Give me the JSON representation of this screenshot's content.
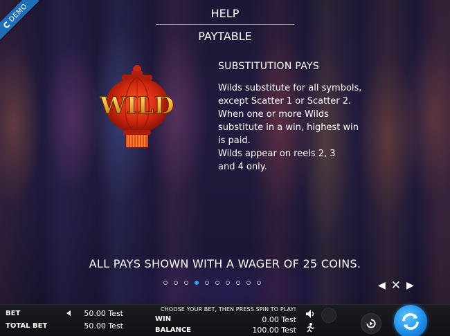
{
  "demo_badge": {
    "text": "DEMO"
  },
  "header": {
    "help_title": "HELP",
    "paytable_title": "PAYTABLE"
  },
  "symbol": {
    "label": "WILD",
    "icon": "wild-lantern-icon",
    "colors": {
      "lantern": "#c42a12",
      "gold": "#f2b43a"
    }
  },
  "info": {
    "heading": "SUBSTITUTION PAYS",
    "lines": [
      "Wilds substitute for all symbols,",
      "except Scatter 1 or Scatter 2.",
      "When one or more Wilds",
      "substitute in a win, highest win",
      "is paid.",
      "Wilds appear on reels 2, 3",
      "and 4 only."
    ]
  },
  "pays_note": "ALL PAYS SHOWN WITH A WAGER OF 25 COINS.",
  "pager": {
    "total": 10,
    "active_index": 3,
    "accent": "#35a6ff"
  },
  "nav": {
    "prev": "◀",
    "close": "✕",
    "next": "▶"
  },
  "bottom_bar": {
    "bet_label": "BET",
    "bet_value": "50.00 Test",
    "total_bet_label": "TOTAL BET",
    "total_bet_value": "50.00 Test",
    "prompt": "CHOOSE YOUR BET, THEN PRESS SPIN TO PLAY!",
    "win_label": "WIN",
    "win_value": "0.00 Test",
    "balance_label": "BALANCE",
    "balance_value": "100.00 Test"
  }
}
